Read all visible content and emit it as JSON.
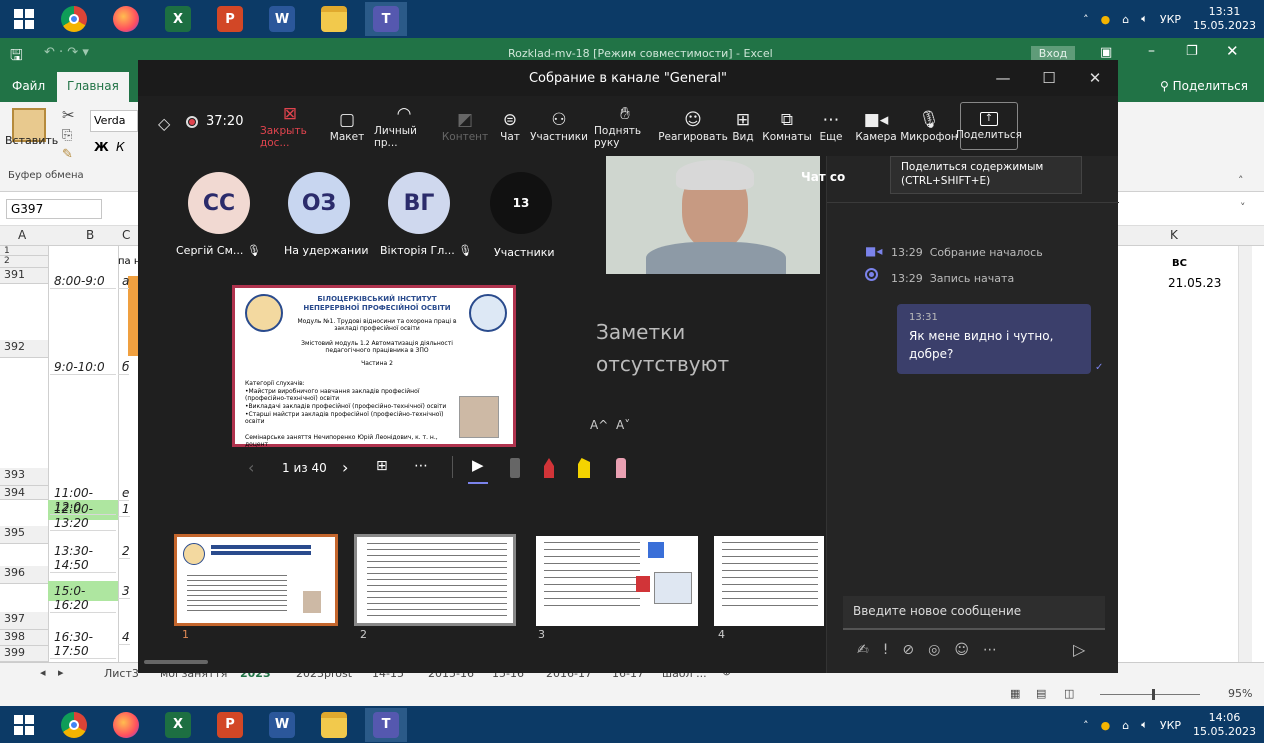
{
  "taskbar_top": {
    "time": "13:31",
    "date": "15.05.2023",
    "lang": "УКР"
  },
  "taskbar_bottom": {
    "time": "14:06",
    "date": "15.05.2023",
    "lang": "УКР"
  },
  "taskbar_apps": [
    "start-icon",
    "chrome-icon",
    "firefox-icon",
    "excel-icon",
    "powerpoint-icon",
    "word-icon",
    "file-explorer-icon",
    "teams-icon"
  ],
  "excel": {
    "title": "Rozklad-mv-18 [Режим совместимости] - Excel",
    "signin": "Вход",
    "share": "Поделиться",
    "tabs": [
      "Файл",
      "Главная"
    ],
    "ribbon": {
      "paste": "Вставить",
      "font": "Verda",
      "clipboard": "Буфер обмена",
      "bold": "Ж",
      "italic": "К"
    },
    "name_box": "G397",
    "columns": [
      "A",
      "B",
      "C"
    ],
    "right_col": "K",
    "row2_right": "ВС",
    "date_cell": "21.05.23",
    "row2_c": "па н",
    "rows": [
      {
        "num": "1"
      },
      {
        "num": "2"
      },
      {
        "num": "391",
        "b": "8:00-9:0",
        "c": "а"
      },
      {
        "num": "392"
      },
      {
        "num": "",
        "b": "9:0-10:0",
        "c": "б"
      },
      {
        "num": "393"
      },
      {
        "num": "394",
        "b": "11:00-12:0",
        "c": "е"
      },
      {
        "num": "395",
        "b": "12:00-13:20",
        "c": "1"
      },
      {
        "num": "",
        "b": "13:30-14:50",
        "c": "2"
      },
      {
        "num": "396"
      },
      {
        "num": "",
        "b": "15:0-16:20",
        "c": "3"
      },
      {
        "num": "397"
      },
      {
        "num": "398",
        "b": "16:30-17:50",
        "c": "4"
      },
      {
        "num": "399"
      }
    ],
    "sheet_tabs": [
      "Лист3",
      "мої заняття",
      "2023",
      "2023prost",
      "14-15",
      "2015-16",
      "15-16",
      "2016-17",
      "16-17",
      "шабл ..."
    ],
    "zoom": "95%"
  },
  "teams": {
    "window_title": "Собрание в канале \"General\"",
    "timer": "37:20",
    "toolbar": [
      {
        "label": "Закрыть дос...",
        "icon": "stop-share-icon",
        "state": "red"
      },
      {
        "label": "Макет",
        "icon": "layout-icon",
        "state": "normal"
      },
      {
        "label": "Личный пр...",
        "icon": "private-view-icon",
        "state": "normal"
      },
      {
        "label": "Контент",
        "icon": "content-icon",
        "state": "dim"
      },
      {
        "label": "Чат",
        "icon": "chat-icon",
        "state": "normal"
      },
      {
        "label": "Участники",
        "icon": "participants-icon",
        "state": "normal"
      },
      {
        "label": "Поднять руку",
        "icon": "raise-hand-icon",
        "state": "normal"
      },
      {
        "label": "Реагировать",
        "icon": "react-icon",
        "state": "normal"
      },
      {
        "label": "Вид",
        "icon": "view-icon",
        "state": "normal"
      },
      {
        "label": "Комнаты",
        "icon": "rooms-icon",
        "state": "normal"
      },
      {
        "label": "Еще",
        "icon": "more-icon",
        "state": "normal"
      },
      {
        "label": "Камера",
        "icon": "camera-icon",
        "state": "normal"
      },
      {
        "label": "Микрофон",
        "icon": "microphone-icon",
        "state": "normal"
      },
      {
        "label": "Поделиться",
        "icon": "share-icon",
        "state": "active"
      }
    ],
    "tooltip": {
      "line1": "Поделиться содержимым",
      "line2": "(CTRL+SHIFT+E)"
    },
    "participants": [
      {
        "initials": "СС",
        "name": "Сергій См...",
        "color": "#f1d9d2"
      },
      {
        "initials": "ОЗ",
        "name": "На удержании",
        "color": "#c8d6f0"
      },
      {
        "initials": "ВГ",
        "name": "Вікторія Гл...",
        "color": "#cfd8ee"
      }
    ],
    "participants_count": {
      "count": "13",
      "label": "Участники"
    },
    "notes": "Заметки отсутствуют",
    "font_buttons": [
      "A^",
      "A˅"
    ],
    "slide_nav": {
      "counter": "1 из 40"
    },
    "slide": {
      "inst1": "БІЛОЦЕРКІВСЬКИЙ ІНСТИТУТ",
      "inst2": "НЕПЕРЕРВНОЇ ПРОФЕСІЙНОЇ ОСВІТИ",
      "module": "Модуль №1. Трудові відносини та охорона праці в закладі професійної освіти",
      "content_module": "Змістовий модуль 1.2 Автоматизація діяльності педагогічного працівника в ЗПО",
      "part": "Частина 2",
      "cat_title": "Категорії слухачів:",
      "cat1": "•Майстри виробничого навчання закладів професійної (професійно-технічної) освіти",
      "cat2": "•Викладачі закладів професійної (професійно-технічної) освіти",
      "cat3": "•Старші майстри закладів професійної (професійно-технічної) освіти",
      "footer": "Семінарське заняття   Нечипоренко Юрій Леонідович, к. т. н., доцент"
    },
    "thumbs": [
      "1",
      "2",
      "3",
      "4"
    ],
    "chat": {
      "title": "Чат со",
      "events": [
        {
          "time": "13:29",
          "text": "Собрание началось",
          "icon": "meeting-icon"
        },
        {
          "time": "13:29",
          "text": "Запись начата",
          "icon": "record-icon"
        }
      ],
      "message": {
        "time": "13:31",
        "text": "Як мене видно і чутно, добре?"
      },
      "input_placeholder": "Введите новое сообщение"
    }
  }
}
